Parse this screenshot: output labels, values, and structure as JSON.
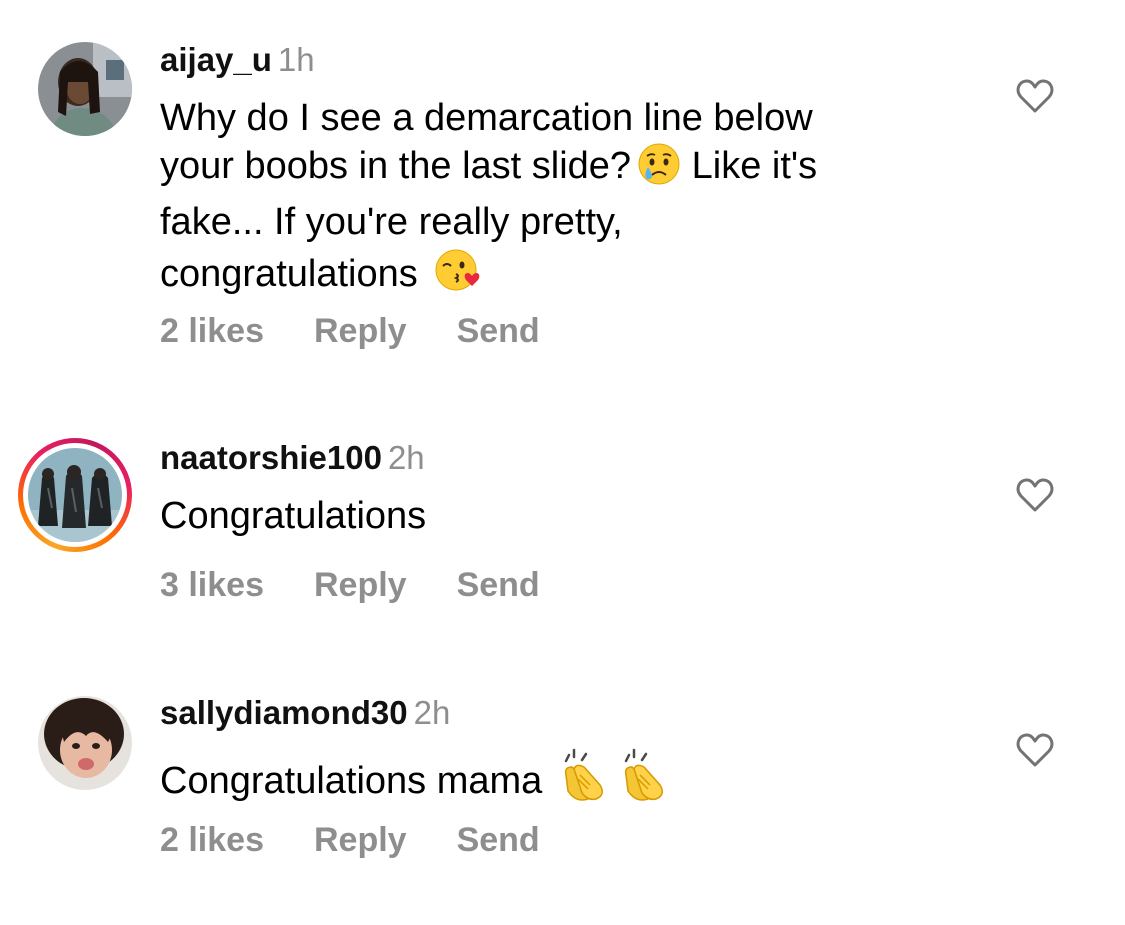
{
  "comments": [
    {
      "username": "aijay_u",
      "time": "1h",
      "text_lines": [
        "Why do I see a demarcation line below",
        "your boobs in the last slide?",
        "Like it's",
        "fake... If you're really pretty,",
        "congratulations"
      ],
      "emojis": [
        "crying-face",
        "kiss-face"
      ],
      "likes": "2 likes",
      "reply": "Reply",
      "send": "Send"
    },
    {
      "username": "naatorshie100",
      "time": "2h",
      "text": "Congratulations",
      "likes": "3 likes",
      "reply": "Reply",
      "send": "Send"
    },
    {
      "username": "sallydiamond30",
      "time": "2h",
      "text": "Congratulations mama",
      "emojis": [
        "clapping-hands",
        "clapping-hands"
      ],
      "likes": "2 likes",
      "reply": "Reply",
      "send": "Send"
    }
  ],
  "colors": {
    "text": "#000000",
    "secondary": "#8e8e8e",
    "story_ring_start": "#f9a825",
    "story_ring_end": "#e91e63"
  }
}
